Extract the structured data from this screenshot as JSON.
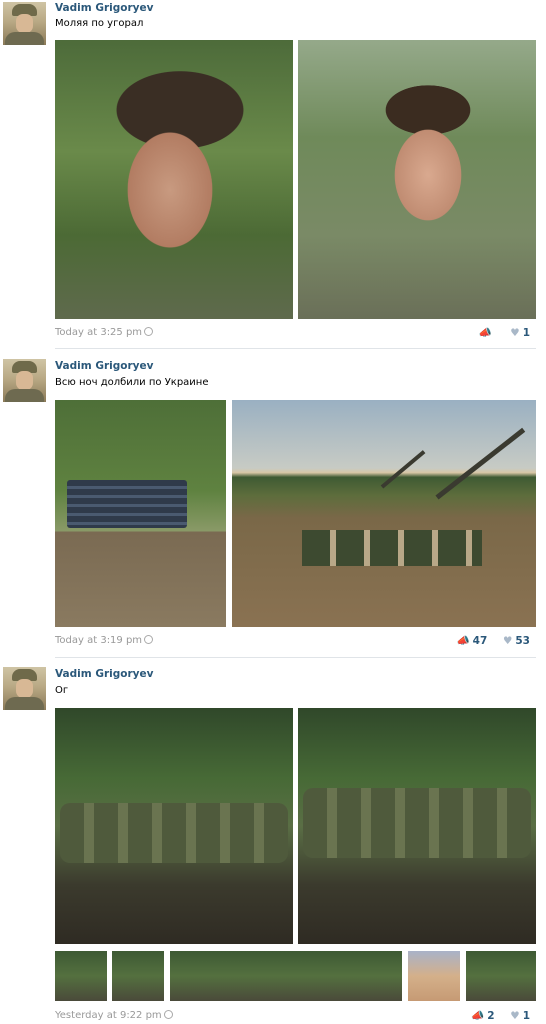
{
  "posts": [
    {
      "author": "Vadim Grigoryev",
      "text": "Моляя по угорал",
      "time": "Today at 3:25 pm",
      "likes": "1",
      "reposts": ""
    },
    {
      "author": "Vadim Grigoryev",
      "text": "Всю ноч долбили по Украине",
      "time": "Today at 3:19 pm",
      "reposts": "47",
      "likes": "53"
    },
    {
      "author": "Vadim Grigoryev",
      "text": "Ог",
      "time": "Yesterday at 9:22 pm",
      "reposts": "2",
      "likes": "1"
    }
  ],
  "icons": {
    "repost": "megaphone-icon",
    "like": "heart-icon",
    "clock": "clock-icon"
  },
  "colors": {
    "author_link": "#2b587a",
    "meta_text": "#999999",
    "stat_text": "#2b587a"
  }
}
